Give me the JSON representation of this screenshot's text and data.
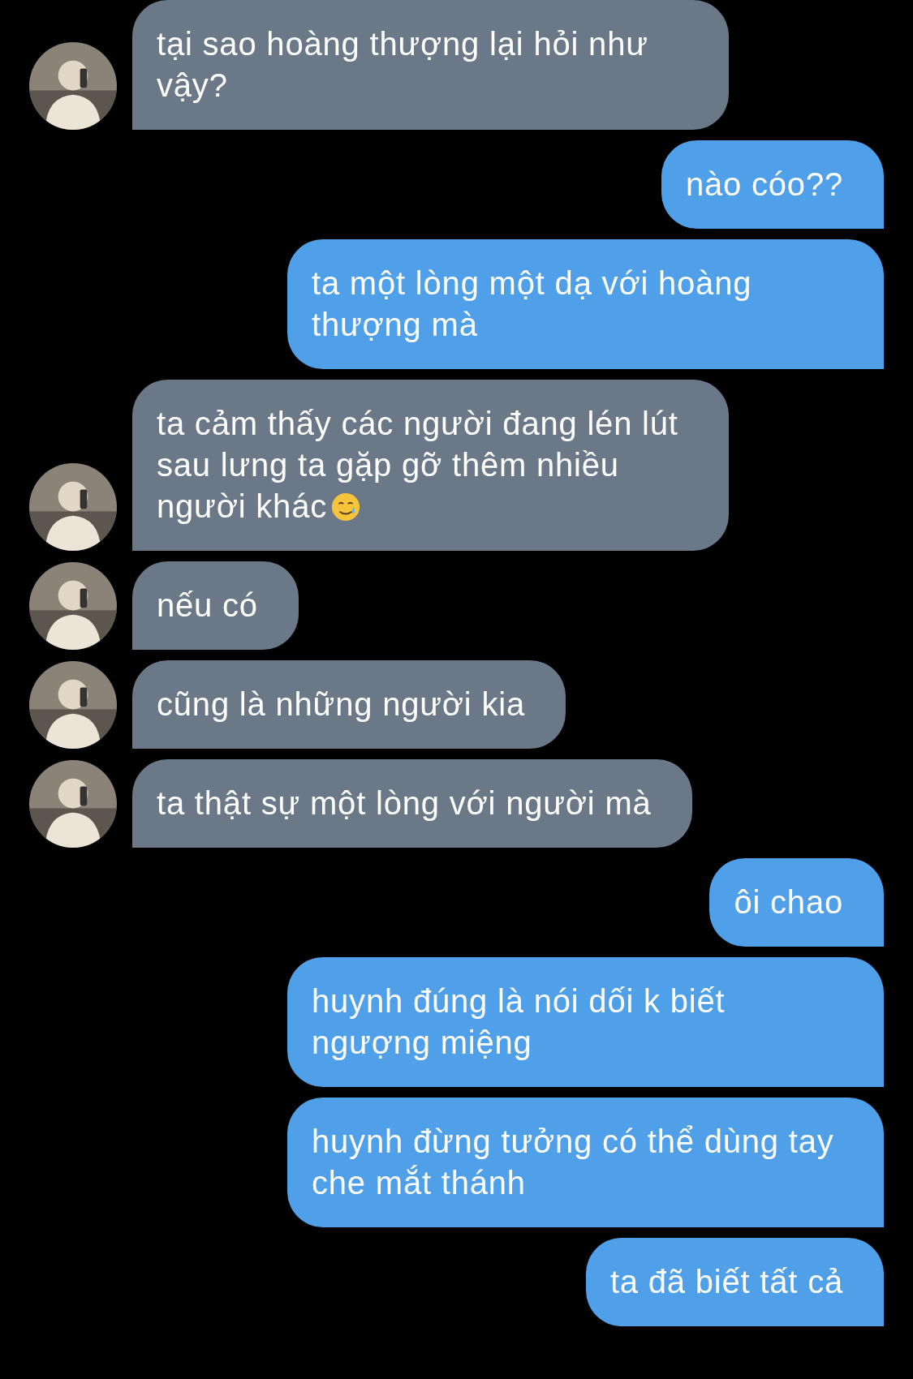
{
  "messages": [
    {
      "kind": "received",
      "text": "tại sao hoàng thượng lại hỏi như vậy?",
      "avatar": true
    },
    {
      "kind": "sent",
      "text": "nào cóo??"
    },
    {
      "kind": "sent",
      "text": "ta một lòng một dạ với hoàng thượng mà"
    },
    {
      "kind": "received",
      "text": "ta cảm thấy các người đang lén lút sau lưng ta gặp gỡ thêm nhiều người khác",
      "avatar": true,
      "emoji": true
    },
    {
      "kind": "received",
      "text": "nếu có",
      "avatar": true
    },
    {
      "kind": "received",
      "text": "cũng là những người kia",
      "avatar": true
    },
    {
      "kind": "received",
      "text": "ta thật sự một lòng với người mà",
      "avatar": true
    },
    {
      "kind": "sent",
      "text": "ôi chao"
    },
    {
      "kind": "sent",
      "text": "huynh đúng là nói dối k biết ngượng miệng"
    },
    {
      "kind": "sent",
      "text": "huynh đừng tưởng có thể dùng tay che mắt thánh"
    },
    {
      "kind": "sent",
      "text": "ta đã biết tất cả"
    }
  ]
}
